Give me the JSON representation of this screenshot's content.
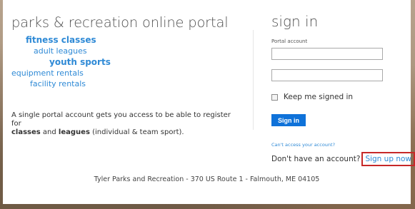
{
  "header": {
    "title": "parks & recreation online portal"
  },
  "nav": {
    "items": [
      {
        "label": "fitness classes"
      },
      {
        "label": "adult leagues"
      },
      {
        "label": "youth sports"
      },
      {
        "label": "equipment rentals"
      },
      {
        "label": "facility rentals"
      }
    ]
  },
  "blurb": {
    "line1": "A single portal account gets you access to be able to register for",
    "classes": "classes",
    "and": " and ",
    "leagues": "leagues",
    "rest": " (individual & team sport)."
  },
  "signin": {
    "title": "sign in",
    "portal_label": "Portal account",
    "account_value": "",
    "password_value": "",
    "keep_label": "Keep me signed in",
    "button_label": "Sign in",
    "cant_access": "Can't access your account?",
    "no_account": "Don't have an account?",
    "signup_label": "Sign up now"
  },
  "footer": {
    "text": "Tyler Parks and Recreation - 370 US Route 1 - Falmouth, ME 04105"
  },
  "colors": {
    "link": "#2f8ad6",
    "button": "#0f72d9",
    "highlight_border": "#c62828"
  }
}
